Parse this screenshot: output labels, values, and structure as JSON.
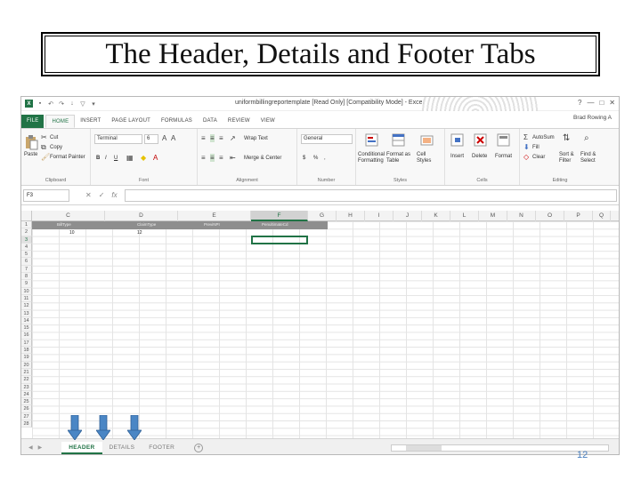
{
  "slide": {
    "title": "The Header, Details and Footer Tabs",
    "page_number": "12"
  },
  "window": {
    "title": "uniformbillingreportemplate [Read Only] [Compatibility Mode] - Excel",
    "user": "Brad Rowing A",
    "controls": [
      "?",
      "—",
      "□",
      "✕"
    ]
  },
  "ribbon_tabs": [
    "FILE",
    "HOME",
    "INSERT",
    "PAGE LAYOUT",
    "FORMULAS",
    "DATA",
    "REVIEW",
    "VIEW"
  ],
  "clipboard": {
    "paste": "Paste",
    "cut": "Cut",
    "copy": "Copy",
    "format_painter": "Format Painter",
    "label": "Clipboard"
  },
  "font": {
    "name": "Terminal",
    "size": "6",
    "bold": "B",
    "italic": "I",
    "underline": "U",
    "label": "Font"
  },
  "alignment": {
    "wrap": "Wrap Text",
    "merge": "Merge & Center",
    "label": "Alignment"
  },
  "number": {
    "format": "General",
    "currency": "$",
    "percent": "%",
    "comma": ",",
    "label": "Number"
  },
  "styles": {
    "conditional": "Conditional Formatting",
    "format_table": "Format as Table",
    "cell_styles": "Cell Styles",
    "label": "Styles"
  },
  "cells_group": {
    "insert": "Insert",
    "delete": "Delete",
    "format": "Format",
    "label": "Cells"
  },
  "editing": {
    "autosum": "AutoSum",
    "fill": "Fill",
    "clear": "Clear",
    "sort": "Sort & Filter",
    "find": "Find & Select",
    "label": "Editing"
  },
  "formula_bar": {
    "name_box": "F3",
    "fx": "fx"
  },
  "columns": [
    "C",
    "D",
    "E",
    "F",
    "G",
    "H",
    "I",
    "J",
    "K",
    "L",
    "M",
    "N",
    "O",
    "P",
    "Q"
  ],
  "selected_column": "F",
  "rows": [
    "1",
    "2",
    "3",
    "4",
    "5",
    "6",
    "7",
    "8",
    "9",
    "10",
    "11",
    "12",
    "13",
    "14",
    "15",
    "16",
    "17",
    "18",
    "19",
    "20",
    "21",
    "22",
    "23",
    "24",
    "25",
    "26",
    "27",
    "28"
  ],
  "selected_row": "3",
  "header_cells": [
    "BillType",
    "ClaimType",
    "PreviNPI",
    "PenultimateCd"
  ],
  "value_cells": [
    "10",
    "12"
  ],
  "sheet_tabs": [
    "HEADER",
    "DETAILS",
    "FOOTER"
  ],
  "active_sheet": "HEADER",
  "colors": {
    "excel_green": "#217346",
    "arrow_blue": "#4a86c5",
    "page_number": "#4a7fbf"
  }
}
